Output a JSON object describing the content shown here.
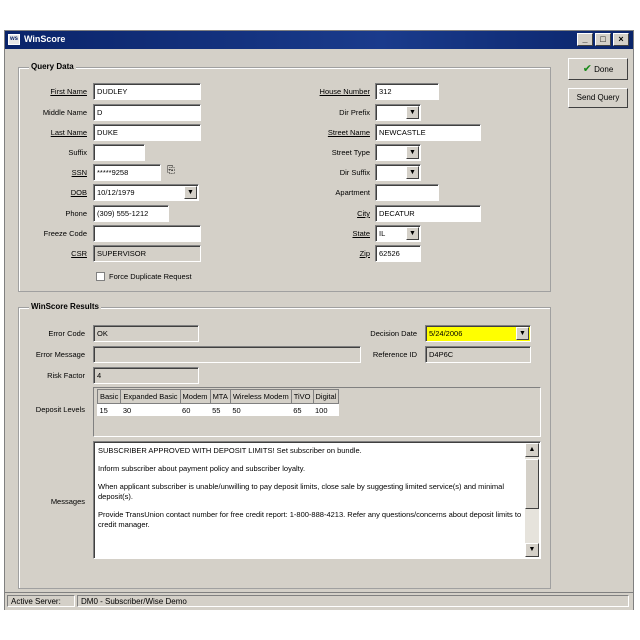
{
  "window": {
    "title": "WinScore",
    "minimize_label": "_",
    "maximize_label": "□",
    "close_label": "×"
  },
  "buttons": {
    "done": "Done",
    "done_check": "✔",
    "send_query": "Send Query"
  },
  "query_data": {
    "title": "Query Data",
    "first_name": {
      "label": "First Name",
      "value": "DUDLEY"
    },
    "middle_name": {
      "label": "Middle Name",
      "value": "D"
    },
    "last_name": {
      "label": "Last Name",
      "value": "DUKE"
    },
    "suffix": {
      "label": "Suffix",
      "value": ""
    },
    "ssn": {
      "label": "SSN",
      "value": "*****9258"
    },
    "dob": {
      "label": "DOB",
      "value": "10/12/1979"
    },
    "phone": {
      "label": "Phone",
      "value": "(309) 555-1212"
    },
    "freeze_code": {
      "label": "Freeze Code",
      "value": ""
    },
    "csr": {
      "label": "CSR",
      "value": "SUPERVISOR"
    },
    "force_duplicate": {
      "label": "Force Duplicate Request",
      "checked": false
    },
    "house_number": {
      "label": "House Number",
      "value": "312"
    },
    "dir_prefix": {
      "label": "Dir Prefix",
      "value": ""
    },
    "street_name": {
      "label": "Street Name",
      "value": "NEWCASTLE"
    },
    "street_type": {
      "label": "Street Type",
      "value": ""
    },
    "dir_suffix": {
      "label": "Dir Suffix",
      "value": ""
    },
    "apartment": {
      "label": "Apartment",
      "value": ""
    },
    "city": {
      "label": "City",
      "value": "DECATUR"
    },
    "state": {
      "label": "State",
      "value": "IL"
    },
    "zip": {
      "label": "Zip",
      "value": "62526"
    }
  },
  "results": {
    "title": "WinScore Results",
    "error_code": {
      "label": "Error Code",
      "value": "OK"
    },
    "error_message": {
      "label": "Error Message",
      "value": ""
    },
    "risk_factor": {
      "label": "Risk Factor",
      "value": "4"
    },
    "decision_date": {
      "label": "Decision Date",
      "value": "5/24/2006"
    },
    "reference_id": {
      "label": "Reference ID",
      "value": "D4P6C"
    },
    "deposit_levels_label": "Deposit Levels",
    "deposit_headers": [
      "Basic",
      "Expanded Basic",
      "Modem",
      "MTA",
      "Wireless Modem",
      "TiVO",
      "Digital"
    ],
    "deposit_values": [
      "15",
      "30",
      "60",
      "55",
      "50",
      "65",
      "100"
    ],
    "messages_label": "Messages",
    "messages": [
      "SUBSCRIBER APPROVED WITH DEPOSIT LIMITS! Set subscriber on bundle.",
      "Inform subscriber about payment policy and subscriber loyalty.",
      "When applicant subscriber is unable/unwilling to pay deposit limits, close sale by suggesting limited service(s) and minimal deposit(s).",
      "Provide TransUnion contact number for free credit report: 1-800-888-4213.  Refer any questions/concerns about deposit limits to credit manager."
    ]
  },
  "status_bar": {
    "label": "Active Server:",
    "value": "DM0 - Subscriber/Wise Demo"
  }
}
